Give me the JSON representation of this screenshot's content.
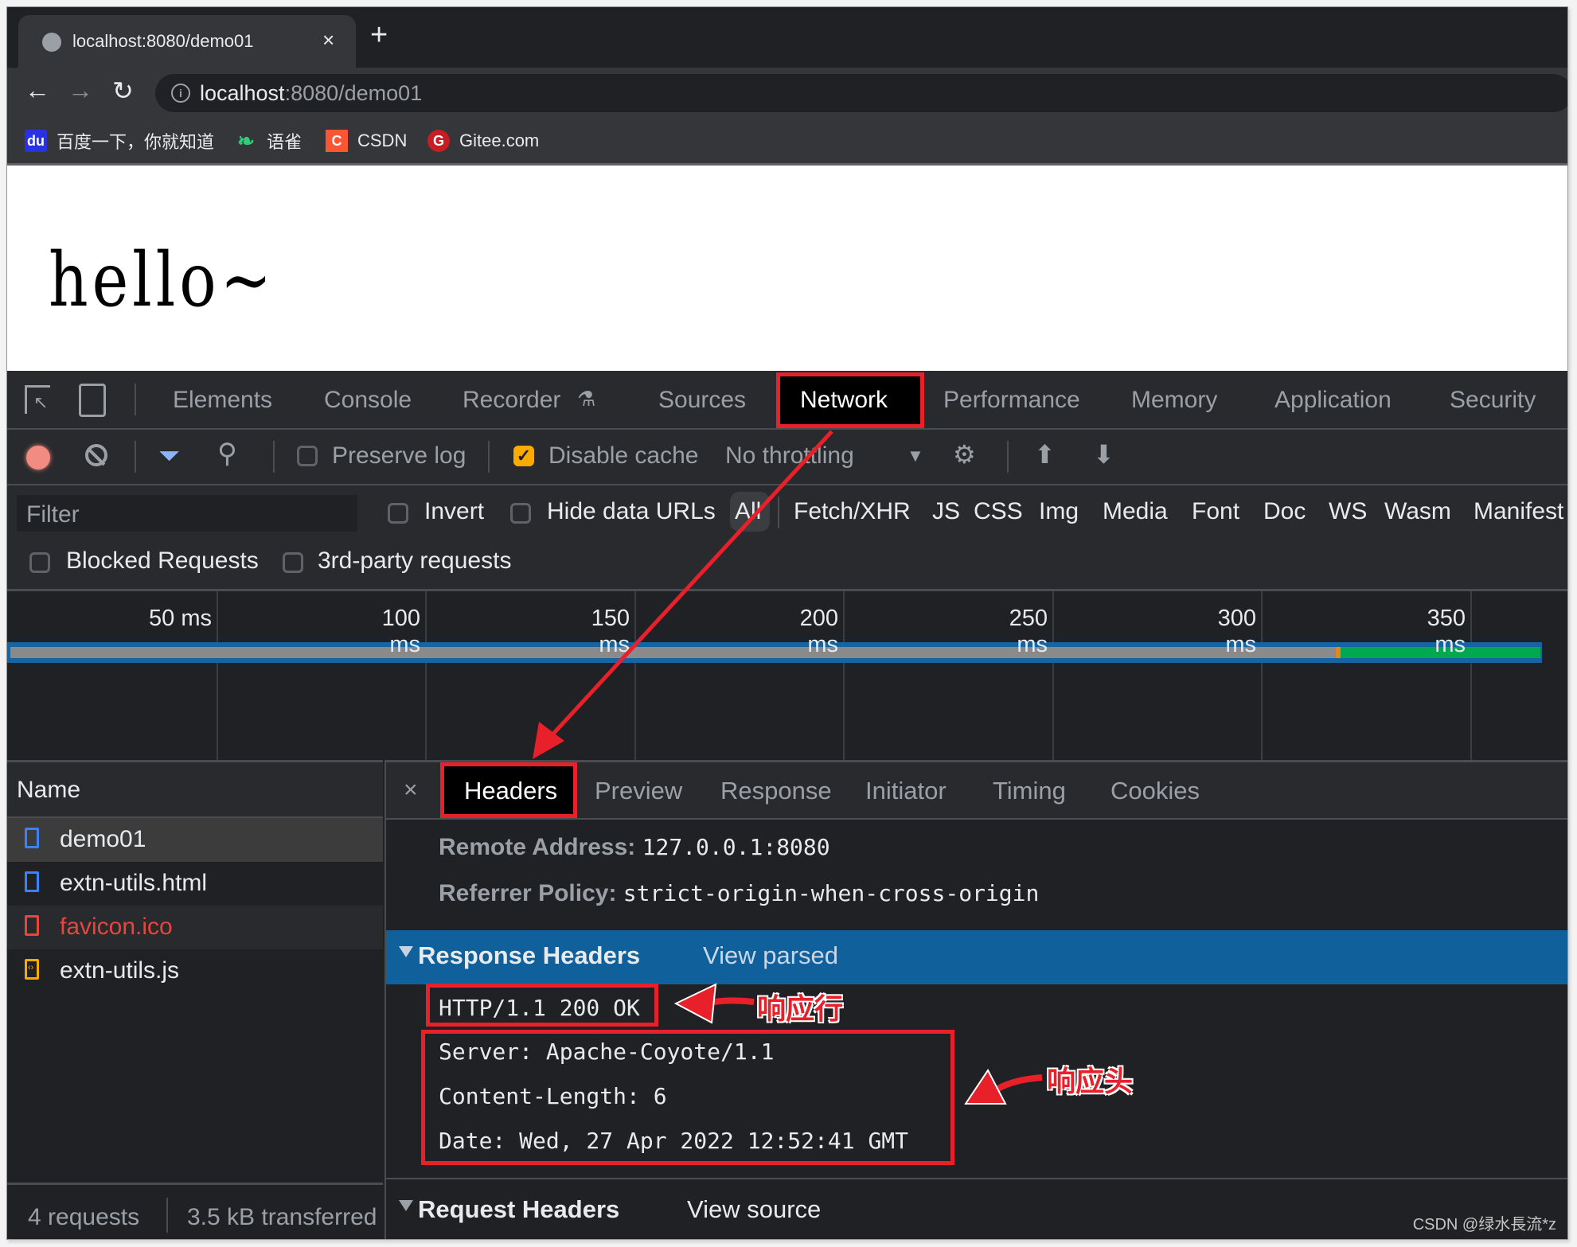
{
  "browser": {
    "tab_title": "localhost:8080/demo01",
    "url_host": "localhost",
    "url_rest": ":8080/demo01",
    "bookmarks": [
      {
        "label": "百度一下，你就知道",
        "icon": "baidu-icon",
        "color": "#2932e1"
      },
      {
        "label": "语雀",
        "icon": "yuque-icon",
        "color": "#31cc79"
      },
      {
        "label": "CSDN",
        "icon": "csdn-icon",
        "color": "#fc5531"
      },
      {
        "label": "Gitee.com",
        "icon": "gitee-icon",
        "color": "#c71d23"
      }
    ]
  },
  "page": {
    "text": "hello~"
  },
  "devtools": {
    "tabs": [
      "Elements",
      "Console",
      "Recorder",
      "Sources",
      "Network",
      "Performance",
      "Memory",
      "Application",
      "Security"
    ],
    "selected_tab": "Network",
    "toolbar": {
      "preserve_log": "Preserve log",
      "preserve_log_checked": false,
      "disable_cache": "Disable cache",
      "disable_cache_checked": true,
      "throttling": "No throttling"
    },
    "filter": {
      "placeholder": "Filter",
      "invert": "Invert",
      "hide_data_urls": "Hide data URLs",
      "types": [
        "All",
        "Fetch/XHR",
        "JS",
        "CSS",
        "Img",
        "Media",
        "Font",
        "Doc",
        "WS",
        "Wasm",
        "Manifest"
      ],
      "selected_type": "All",
      "blocked_requests": "Blocked Requests",
      "third_party": "3rd-party requests"
    },
    "timeline": {
      "ticks": [
        "50 ms",
        "100 ms",
        "150 ms",
        "200 ms",
        "250 ms",
        "300 ms",
        "350 ms"
      ]
    },
    "requests": {
      "header": "Name",
      "items": [
        {
          "name": "demo01",
          "type": "document",
          "error": false
        },
        {
          "name": "extn-utils.html",
          "type": "document",
          "error": false
        },
        {
          "name": "favicon.ico",
          "type": "other",
          "error": true
        },
        {
          "name": "extn-utils.js",
          "type": "script",
          "error": false
        }
      ],
      "footer_count": "4 requests",
      "footer_transferred": "3.5 kB transferred"
    },
    "details": {
      "tabs": [
        "Headers",
        "Preview",
        "Response",
        "Initiator",
        "Timing",
        "Cookies"
      ],
      "selected_tab": "Headers",
      "general": [
        {
          "key": "Remote Address:",
          "value": "127.0.0.1:8080"
        },
        {
          "key": "Referrer Policy:",
          "value": "strict-origin-when-cross-origin"
        }
      ],
      "response_headers": {
        "title": "Response Headers",
        "link": "View parsed",
        "status_line": "HTTP/1.1 200 OK",
        "headers": [
          "Server: Apache-Coyote/1.1",
          "Content-Length: 6",
          "Date: Wed, 27 Apr 2022 12:52:41 GMT"
        ]
      },
      "request_headers": {
        "title": "Request Headers",
        "link": "View source"
      }
    }
  },
  "annotations": {
    "status_line_label": "响应行",
    "headers_label": "响应头"
  },
  "watermark": "CSDN @绿水長流*z"
}
